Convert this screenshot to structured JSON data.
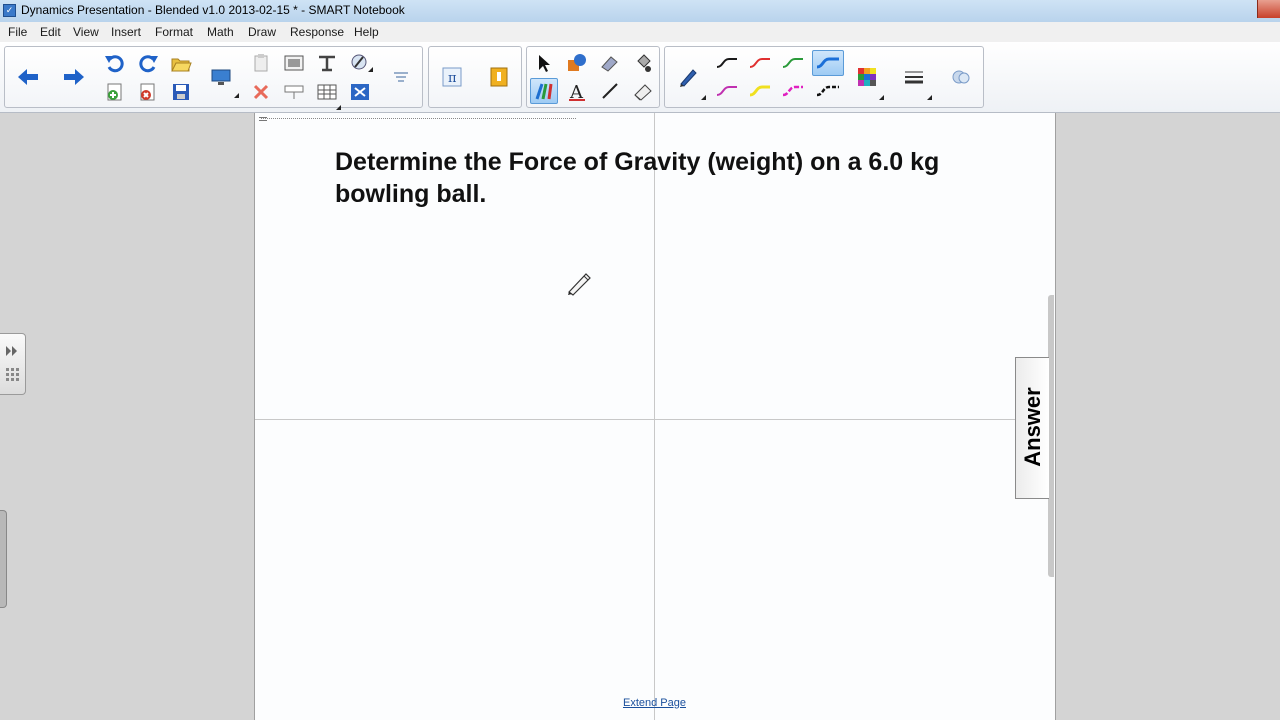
{
  "window": {
    "title": "Dynamics Presentation - Blended v1.0 2013-02-15 * - SMART Notebook"
  },
  "menu": [
    "File",
    "Edit",
    "View",
    "Insert",
    "Format",
    "Math",
    "Draw",
    "Response",
    "Help"
  ],
  "toolbar": {
    "icons": [
      "back-icon",
      "forward-icon",
      "undo-icon",
      "redo-icon",
      "add-page-icon",
      "delete-page-icon",
      "open-file-icon",
      "save-icon",
      "screen-icon",
      "paste-icon",
      "delete-icon",
      "screenshade-icon",
      "table-icon",
      "document-camera-icon",
      "clear-page-icon",
      "math-icon",
      "response-icon",
      "select-icon",
      "shapes-icon",
      "magic-pen-icon",
      "fill-icon",
      "pens-icon",
      "text-icon",
      "line-icon",
      "eraser-icon",
      "pen-icon",
      "color-palette-icon",
      "line-properties-icon",
      "properties-icon"
    ],
    "colors": {
      "pen_black": "#1a1a1a",
      "pen_red": "#e03030",
      "pen_green": "#2a9a3a",
      "pen_blue": "#1b6fd8",
      "pen_magenta": "#c030b0",
      "pen_yellow": "#f0e020",
      "pen_pink": "#e020c0",
      "accent": "#5a9bd8"
    }
  },
  "page": {
    "question": "Determine the Force of Gravity (weight) on a 6.0 kg bowling ball.",
    "extend_link": "Extend Page"
  },
  "answer_tab": {
    "label": "Answer"
  }
}
